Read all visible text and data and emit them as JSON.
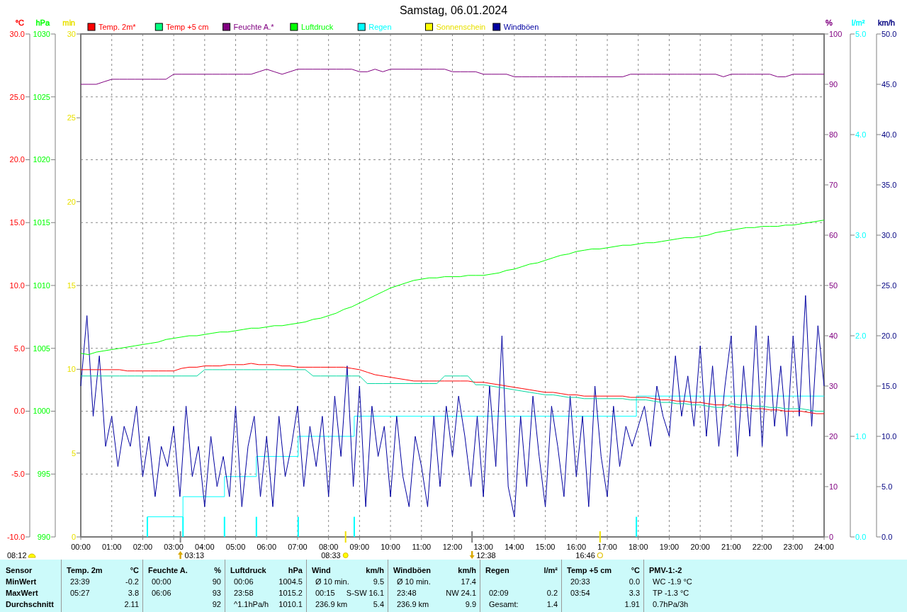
{
  "title": "Samstag, 06.01.2024",
  "legend": [
    {
      "label": "Temp. 2m*",
      "color": "#ff0000",
      "swatch": {
        "color": "#ff0000"
      }
    },
    {
      "label": "Temp +5 cm",
      "color": "#ff0000",
      "swatch": {
        "color": "#00ff80"
      }
    },
    {
      "label": "Feuchte A.*",
      "color": "#800080",
      "swatch": {
        "color": "#800080"
      }
    },
    {
      "label": "Luftdruck",
      "color": "#00ff00",
      "swatch": {
        "color": "#00ff00"
      }
    },
    {
      "label": "Regen",
      "color": "#00ffff",
      "swatch": {
        "color": "#00ffff"
      }
    },
    {
      "label": "Sonnenschein",
      "color": "#e8e000",
      "swatch": {
        "color": "#ffff00"
      }
    },
    {
      "label": "Windböen",
      "color": "#0000a0",
      "swatch": {
        "color": "#0000a0"
      }
    }
  ],
  "left_scales": [
    {
      "color": "#ff0000",
      "chart_data": {
        "type": "line",
        "ylabel": "°C",
        "grid": true,
        "x": [
          0,
          0.25,
          0.5,
          0.75,
          1,
          1.25,
          1.5,
          1.75,
          2,
          2.25,
          2.5,
          2.75,
          3,
          3.25,
          3.5,
          3.75,
          4,
          4.25,
          4.5,
          4.75,
          5,
          5.25,
          5.5,
          5.75,
          6,
          6.25,
          6.5,
          6.75,
          7,
          7.25,
          7.5,
          7.75,
          8,
          8.25,
          8.5,
          8.75,
          9,
          9.25,
          9.5,
          9.75,
          10,
          10.25,
          10.5,
          10.75,
          11,
          11.25,
          11.5,
          11.75,
          12,
          12.25,
          12.5,
          12.75,
          13,
          13.25,
          13.5,
          13.75,
          14,
          14.25,
          14.5,
          14.75,
          15,
          15.25,
          15.5,
          15.75,
          16,
          16.25,
          16.5,
          16.75,
          17,
          17.25,
          17.5,
          17.75,
          18,
          18.25,
          18.5,
          18.75,
          19,
          19.25,
          19.5,
          19.75,
          20,
          20.25,
          20.5,
          20.75,
          21,
          21.25,
          21.5,
          21.75,
          22,
          22.25,
          22.5,
          22.75,
          23,
          23.25,
          23.5,
          23.75,
          24
        ],
        "xlim": [
          0,
          24
        ],
        "ylim": [
          -10,
          30
        ],
        "xticks": [
          {
            "value": 0,
            "label": "00:00"
          },
          {
            "value": 1,
            "label": "01:00"
          },
          {
            "value": 2,
            "label": "02:00"
          },
          {
            "value": 3,
            "label": "03:00"
          },
          {
            "value": 4,
            "label": "04:00"
          },
          {
            "value": 5,
            "label": "05:00"
          },
          {
            "value": 6,
            "label": "06:00"
          },
          {
            "value": 7,
            "label": "07:00"
          },
          {
            "value": 8,
            "label": "08:00"
          },
          {
            "value": 9,
            "label": "09:00"
          },
          {
            "value": 10,
            "label": "10:00"
          },
          {
            "value": 11,
            "label": "11:00"
          },
          {
            "value": 12,
            "label": "12:00"
          },
          {
            "value": 13,
            "label": "13:00"
          },
          {
            "value": 14,
            "label": "14:00"
          },
          {
            "value": 15,
            "label": "15:00"
          },
          {
            "value": 16,
            "label": "16:00"
          },
          {
            "value": 17,
            "label": "17:00"
          },
          {
            "value": 18,
            "label": "18:00"
          },
          {
            "value": 19,
            "label": "19:00"
          },
          {
            "value": 20,
            "label": "20:00"
          },
          {
            "value": 21,
            "label": "21:00"
          },
          {
            "value": 22,
            "label": "22:00"
          },
          {
            "value": 23,
            "label": "23:00"
          },
          {
            "value": 24,
            "label": "24:00"
          }
        ],
        "yticks": [
          {
            "value": -10,
            "label": "-10.0"
          },
          {
            "value": -5,
            "label": "-5.0"
          },
          {
            "value": 0,
            "label": "0.0"
          },
          {
            "value": 5,
            "label": "5.0"
          },
          {
            "value": 10,
            "label": "10.0"
          },
          {
            "value": 15,
            "label": "15.0"
          },
          {
            "value": 20,
            "label": "20.0"
          },
          {
            "value": 25,
            "label": "25.0"
          },
          {
            "value": 30,
            "label": "30.0"
          }
        ],
        "series": [
          {
            "color": "#ff0000",
            "values": [
              3.3,
              3.3,
              3.3,
              3.3,
              3.3,
              3.3,
              3.2,
              3.2,
              3.2,
              3.2,
              3.2,
              3.2,
              3.2,
              3.4,
              3.5,
              3.5,
              3.6,
              3.6,
              3.6,
              3.7,
              3.7,
              3.7,
              3.8,
              3.7,
              3.7,
              3.7,
              3.6,
              3.6,
              3.5,
              3.5,
              3.5,
              3.5,
              3.5,
              3.5,
              3.5,
              3.4,
              3.3,
              3.1,
              2.9,
              2.8,
              2.7,
              2.6,
              2.5,
              2.4,
              2.4,
              2.4,
              2.4,
              2.4,
              2.4,
              2.4,
              2.4,
              2.3,
              2.3,
              2.2,
              2.1,
              2.0,
              1.9,
              1.8,
              1.7,
              1.6,
              1.5,
              1.5,
              1.4,
              1.3,
              1.3,
              1.2,
              1.2,
              1.2,
              1.2,
              1.2,
              1.2,
              1.1,
              1.1,
              1.1,
              1.0,
              0.9,
              0.9,
              0.8,
              0.8,
              0.7,
              0.7,
              0.6,
              0.5,
              0.5,
              0.4,
              0.3,
              0.3,
              0.2,
              0.2,
              0.1,
              0.1,
              0.0,
              0.0,
              0.0,
              -0.1,
              -0.2,
              -0.2
            ]
          },
          {
            "color": "#00d8a0",
            "values": [
              2.8,
              2.8,
              2.8,
              2.8,
              2.8,
              2.8,
              2.8,
              2.8,
              2.8,
              2.8,
              2.8,
              2.8,
              2.8,
              2.8,
              2.8,
              2.8,
              3.3,
              3.3,
              3.3,
              3.3,
              3.3,
              3.3,
              3.3,
              3.3,
              3.3,
              3.3,
              3.3,
              3.3,
              3.3,
              3.3,
              2.8,
              2.8,
              2.8,
              2.8,
              2.8,
              2.8,
              2.8,
              2.2,
              2.2,
              2.2,
              2.2,
              2.2,
              2.2,
              2.2,
              2.2,
              2.2,
              2.2,
              2.8,
              2.8,
              2.8,
              2.8,
              2.1,
              2.1,
              2.0,
              1.9,
              1.8,
              1.7,
              1.6,
              1.5,
              1.4,
              1.3,
              1.3,
              1.2,
              1.1,
              1.1,
              1.0,
              1.0,
              1.0,
              1.0,
              1.0,
              1.0,
              0.9,
              0.9,
              0.9,
              0.8,
              0.7,
              0.7,
              0.6,
              0.6,
              0.5,
              0.5,
              0.4,
              0.3,
              0.3,
              0.6,
              0.5,
              0.5,
              0.4,
              0.4,
              0.3,
              0.3,
              0.2,
              0.2,
              0.2,
              0.1,
              0.0,
              0.0
            ]
          }
        ]
      }
    },
    {
      "color": "#00ff00",
      "chart_data": {
        "type": "line",
        "ylabel": "hPa",
        "x": [
          0,
          0.25,
          0.5,
          0.75,
          1,
          1.25,
          1.5,
          1.75,
          2,
          2.25,
          2.5,
          2.75,
          3,
          3.25,
          3.5,
          3.75,
          4,
          4.25,
          4.5,
          4.75,
          5,
          5.25,
          5.5,
          5.75,
          6,
          6.25,
          6.5,
          6.75,
          7,
          7.25,
          7.5,
          7.75,
          8,
          8.25,
          8.5,
          8.75,
          9,
          9.25,
          9.5,
          9.75,
          10,
          10.25,
          10.5,
          10.75,
          11,
          11.25,
          11.5,
          11.75,
          12,
          12.25,
          12.5,
          12.75,
          13,
          13.25,
          13.5,
          13.75,
          14,
          14.25,
          14.5,
          14.75,
          15,
          15.25,
          15.5,
          15.75,
          16,
          16.25,
          16.5,
          16.75,
          17,
          17.25,
          17.5,
          17.75,
          18,
          18.25,
          18.5,
          18.75,
          19,
          19.25,
          19.5,
          19.75,
          20,
          20.25,
          20.5,
          20.75,
          21,
          21.25,
          21.5,
          21.75,
          22,
          22.25,
          22.5,
          22.75,
          23,
          23.25,
          23.5,
          23.75,
          24
        ],
        "xlim": [
          0,
          24
        ],
        "ylim": [
          990,
          1030
        ],
        "yticks": [
          {
            "value": 990,
            "label": "990"
          },
          {
            "value": 995,
            "label": "995"
          },
          {
            "value": 1000,
            "label": "1000"
          },
          {
            "value": 1005,
            "label": "1005"
          },
          {
            "value": 1010,
            "label": "1010"
          },
          {
            "value": 1015,
            "label": "1015"
          },
          {
            "value": 1020,
            "label": "1020"
          },
          {
            "value": 1025,
            "label": "1025"
          },
          {
            "value": 1030,
            "label": "1030"
          }
        ],
        "series": [
          {
            "color": "#00ff00",
            "values": [
              1004.6,
              1004.5,
              1004.7,
              1004.8,
              1004.9,
              1005.0,
              1005.1,
              1005.2,
              1005.3,
              1005.4,
              1005.5,
              1005.7,
              1005.8,
              1005.9,
              1006.0,
              1006.0,
              1006.1,
              1006.2,
              1006.3,
              1006.3,
              1006.4,
              1006.5,
              1006.6,
              1006.6,
              1006.7,
              1006.8,
              1006.8,
              1006.9,
              1007.0,
              1007.1,
              1007.3,
              1007.4,
              1007.6,
              1007.8,
              1008.1,
              1008.3,
              1008.6,
              1008.9,
              1009.2,
              1009.5,
              1009.8,
              1010.0,
              1010.2,
              1010.4,
              1010.5,
              1010.6,
              1010.6,
              1010.7,
              1010.7,
              1010.7,
              1010.8,
              1010.8,
              1010.8,
              1010.9,
              1011.0,
              1011.2,
              1011.3,
              1011.5,
              1011.7,
              1011.8,
              1012.0,
              1012.2,
              1012.4,
              1012.5,
              1012.7,
              1012.8,
              1012.9,
              1012.9,
              1013.0,
              1013.1,
              1013.2,
              1013.2,
              1013.3,
              1013.4,
              1013.4,
              1013.5,
              1013.6,
              1013.7,
              1013.8,
              1013.8,
              1013.9,
              1014.0,
              1014.2,
              1014.3,
              1014.4,
              1014.5,
              1014.6,
              1014.6,
              1014.7,
              1014.7,
              1014.7,
              1014.8,
              1014.8,
              1014.9,
              1015.0,
              1015.1,
              1015.2
            ]
          }
        ]
      }
    },
    {
      "color": "#e8e000",
      "unit": "min",
      "ticks": [
        "30",
        "25",
        "20",
        "15",
        "10",
        "5",
        "0"
      ]
    }
  ],
  "right_scales": [
    {
      "color": "#800080",
      "chart_data": {
        "type": "line",
        "ylabel": "%",
        "x": [
          0,
          0.25,
          0.5,
          0.75,
          1,
          1.25,
          1.5,
          1.75,
          2,
          2.25,
          2.5,
          2.75,
          3,
          3.25,
          3.5,
          3.75,
          4,
          4.25,
          4.5,
          4.75,
          5,
          5.25,
          5.5,
          5.75,
          6,
          6.25,
          6.5,
          6.75,
          7,
          7.25,
          7.5,
          7.75,
          8,
          8.25,
          8.5,
          8.75,
          9,
          9.25,
          9.5,
          9.75,
          10,
          10.25,
          10.5,
          10.75,
          11,
          11.25,
          11.5,
          11.75,
          12,
          12.25,
          12.5,
          12.75,
          13,
          13.25,
          13.5,
          13.75,
          14,
          14.25,
          14.5,
          14.75,
          15,
          15.25,
          15.5,
          15.75,
          16,
          16.25,
          16.5,
          16.75,
          17,
          17.25,
          17.5,
          17.75,
          18,
          18.25,
          18.5,
          18.75,
          19,
          19.25,
          19.5,
          19.75,
          20,
          20.25,
          20.5,
          20.75,
          21,
          21.25,
          21.5,
          21.75,
          22,
          22.25,
          22.5,
          22.75,
          23,
          23.25,
          23.5,
          23.75,
          24
        ],
        "xlim": [
          0,
          24
        ],
        "ylim": [
          0,
          100
        ],
        "yticks": [
          {
            "value": 0,
            "label": "0"
          },
          {
            "value": 10,
            "label": "10"
          },
          {
            "value": 20,
            "label": "20"
          },
          {
            "value": 30,
            "label": "30"
          },
          {
            "value": 40,
            "label": "40"
          },
          {
            "value": 50,
            "label": "50"
          },
          {
            "value": 60,
            "label": "60"
          },
          {
            "value": 70,
            "label": "70"
          },
          {
            "value": 80,
            "label": "80"
          },
          {
            "value": 90,
            "label": "90"
          },
          {
            "value": 100,
            "label": "100"
          }
        ],
        "series": [
          {
            "color": "#800080",
            "values": [
              90,
              90,
              90,
              90.5,
              91,
              91,
              91,
              91,
              91,
              91,
              91,
              91,
              92,
              92,
              92,
              92,
              92,
              92,
              92,
              92,
              92,
              92,
              92,
              92.5,
              93,
              92.5,
              92,
              92.5,
              93,
              93,
              93,
              93,
              93,
              93,
              93,
              93,
              92.5,
              92.5,
              93,
              92.5,
              93,
              93,
              93,
              93,
              93,
              93,
              93,
              93,
              92.5,
              92.5,
              92.5,
              92.5,
              92,
              92,
              92,
              92,
              91.5,
              91.5,
              91.5,
              91.5,
              91.5,
              91.5,
              91.5,
              91.5,
              91.5,
              91.5,
              91.5,
              91.5,
              91.5,
              91.5,
              91.5,
              92,
              92,
              92,
              92,
              92,
              92,
              92,
              92,
              92,
              92,
              92,
              92,
              91.5,
              92,
              92,
              92,
              92,
              92,
              92,
              91.5,
              91.5,
              92,
              92,
              92,
              92,
              92
            ]
          }
        ]
      }
    },
    {
      "color": "#00ffff",
      "chart_data": {
        "type": "line",
        "ylabel": "l/m²",
        "x": [
          2.15,
          3.3,
          3.3,
          4.64,
          4.64,
          5.67,
          5.67,
          7.02,
          7.02,
          8.83,
          8.83,
          17.94,
          17.94,
          24
        ],
        "xlim": [
          0,
          24
        ],
        "ylim": [
          0,
          5
        ],
        "yticks": [
          {
            "value": 0,
            "label": "0.0"
          },
          {
            "value": 1,
            "label": "1.0"
          },
          {
            "value": 2,
            "label": "2.0"
          },
          {
            "value": 3,
            "label": "3.0"
          },
          {
            "value": 4,
            "label": "4.0"
          },
          {
            "value": 5,
            "label": "5.0"
          }
        ],
        "series": [
          {
            "color": "#00ffff",
            "values": [
              0.2,
              0.2,
              0.4,
              0.4,
              0.6,
              0.6,
              0.8,
              0.8,
              1.0,
              1.0,
              1.2,
              1.2,
              1.4,
              1.4
            ]
          }
        ]
      }
    },
    {
      "color": "#000080",
      "chart_data": {
        "type": "line",
        "ylabel": "km/h",
        "x": [
          0,
          0.2,
          0.4,
          0.6,
          0.8,
          1,
          1.2,
          1.4,
          1.6,
          1.8,
          2,
          2.2,
          2.4,
          2.6,
          2.8,
          3,
          3.2,
          3.4,
          3.6,
          3.8,
          4,
          4.2,
          4.4,
          4.6,
          4.8,
          5,
          5.2,
          5.4,
          5.6,
          5.8,
          6,
          6.2,
          6.4,
          6.6,
          6.8,
          7,
          7.2,
          7.4,
          7.6,
          7.8,
          8,
          8.2,
          8.4,
          8.6,
          8.8,
          9,
          9.2,
          9.4,
          9.6,
          9.8,
          10,
          10.2,
          10.4,
          10.6,
          10.8,
          11,
          11.2,
          11.4,
          11.6,
          11.8,
          12,
          12.2,
          12.4,
          12.6,
          12.8,
          13,
          13.2,
          13.4,
          13.6,
          13.8,
          14,
          14.2,
          14.4,
          14.6,
          14.8,
          15,
          15.2,
          15.4,
          15.6,
          15.8,
          16,
          16.2,
          16.4,
          16.6,
          16.8,
          17,
          17.2,
          17.4,
          17.6,
          17.8,
          18,
          18.2,
          18.4,
          18.6,
          18.8,
          19,
          19.2,
          19.4,
          19.6,
          19.8,
          20,
          20.2,
          20.4,
          20.6,
          20.8,
          21,
          21.2,
          21.4,
          21.6,
          21.8,
          22,
          22.2,
          22.4,
          22.6,
          22.8,
          23,
          23.2,
          23.4,
          23.6,
          23.8,
          24
        ],
        "xlim": [
          0,
          24
        ],
        "ylim": [
          0,
          50
        ],
        "yticks": [
          {
            "value": 0,
            "label": "0.0"
          },
          {
            "value": 5,
            "label": "5.0"
          },
          {
            "value": 10,
            "label": "10.0"
          },
          {
            "value": 15,
            "label": "15.0"
          },
          {
            "value": 20,
            "label": "20.0"
          },
          {
            "value": 25,
            "label": "25.0"
          },
          {
            "value": 30,
            "label": "30.0"
          },
          {
            "value": 35,
            "label": "35.0"
          },
          {
            "value": 40,
            "label": "40.0"
          },
          {
            "value": 45,
            "label": "45.0"
          },
          {
            "value": 50,
            "label": "50.0"
          }
        ],
        "series": [
          {
            "color": "#0000a0",
            "values": [
              15,
              22,
              12,
              18,
              9,
              12,
              7,
              11,
              9,
              13,
              6,
              10,
              4,
              9,
              7,
              11,
              4,
              13,
              6,
              9,
              3,
              10,
              5,
              8,
              4,
              13,
              3,
              9,
              12,
              4,
              10,
              3,
              12,
              6,
              9,
              13,
              5,
              11,
              7,
              12,
              4,
              14,
              8,
              17,
              5,
              15,
              3,
              13,
              8,
              11,
              4,
              12,
              6,
              3,
              10,
              7,
              3,
              12,
              5,
              13,
              8,
              14,
              10,
              5,
              12,
              4,
              15,
              7,
              20,
              5,
              2,
              12,
              5,
              14,
              8,
              3,
              13,
              9,
              4,
              14,
              6,
              12,
              3,
              15,
              8,
              4,
              13,
              7,
              11,
              9,
              11,
              13,
              9,
              15,
              12,
              10,
              18,
              12,
              16,
              11,
              19,
              10,
              17,
              9,
              15,
              20,
              8,
              17,
              10,
              21,
              9,
              20,
              11,
              17,
              10,
              20,
              12,
              24,
              11,
              21,
              15
            ]
          }
        ]
      }
    }
  ],
  "rain_bars": {
    "chart_data": {
      "type": "bar",
      "x": [
        2.15,
        3.3,
        4.64,
        5.67,
        7.02,
        8.83,
        17.94
      ],
      "xlim": [
        0,
        24
      ],
      "ylim": [
        0,
        5
      ],
      "series": [
        {
          "color": "#00ffff",
          "values": [
            0.2,
            0.2,
            0.2,
            0.2,
            0.2,
            0.2,
            0.2
          ]
        }
      ]
    }
  },
  "astro_events": [
    {
      "kind": "moonrise",
      "time": "03:13"
    },
    {
      "kind": "sunrise",
      "time": "08:33"
    },
    {
      "kind": "moonset",
      "time": "12:38"
    },
    {
      "kind": "sunset",
      "time": "16:46"
    }
  ],
  "day_length": "08:12",
  "stats_table": {
    "header": "Sensor",
    "row_labels": [
      "MinWert",
      "MaxWert",
      "Durchschnitt"
    ],
    "columns": [
      {
        "title": "Temp. 2m",
        "unit": "°C",
        "cells": [
          {
            "label": "23:39",
            "value": "-0.2"
          },
          {
            "label": "05:27",
            "value": "3.8"
          },
          {
            "value": "2.11"
          }
        ]
      },
      {
        "title": "Feuchte A.",
        "unit": "%",
        "cells": [
          {
            "label": "00:00",
            "value": "90"
          },
          {
            "label": "06:06",
            "value": "93"
          },
          {
            "value": "92"
          }
        ]
      },
      {
        "title": "Luftdruck",
        "unit": "hPa",
        "cells": [
          {
            "label": "00:06",
            "value": "1004.5"
          },
          {
            "label": "23:58",
            "value": "1015.2"
          },
          {
            "label": "^1.1hPa/h",
            "value": "1010.1"
          }
        ]
      },
      {
        "title": "Wind",
        "unit": "km/h",
        "cells": [
          {
            "label": "Ø 10 min.",
            "value": "9.5"
          },
          {
            "label": "00:15",
            "value": "S-SW 16.1"
          },
          {
            "label": "236.9 km",
            "value": "5.4"
          }
        ]
      },
      {
        "title": "Windböen",
        "unit": "km/h",
        "cells": [
          {
            "label": "Ø 10 min.",
            "value": "17.4"
          },
          {
            "label": "23:48",
            "value": "NW 24.1"
          },
          {
            "label": "236.9 km",
            "value": "9.9"
          }
        ]
      },
      {
        "title": "Regen",
        "unit": "l/m²",
        "cells": [
          {},
          {
            "label": "02:09",
            "value": "0.2"
          },
          {
            "label": "Gesamt:",
            "value": "1.4"
          }
        ]
      },
      {
        "title": "Temp +5 cm",
        "unit": "°C",
        "cells": [
          {
            "label": "20:33",
            "value": "0.0"
          },
          {
            "label": "03:54",
            "value": "3.3"
          },
          {
            "value": "1.91"
          }
        ]
      },
      {
        "title": "PMV-1:-2",
        "cells": [
          {
            "label": "WC -1.9 °C"
          },
          {
            "label": "TP -1.3 °C"
          },
          {
            "label": "0.7hPa/3h"
          }
        ]
      }
    ]
  }
}
